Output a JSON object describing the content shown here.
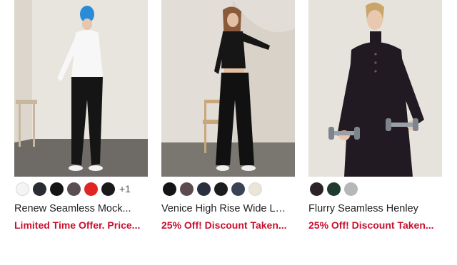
{
  "products": [
    {
      "name": "Renew Seamless Mock...",
      "promo": "Limited Time Offer. Price...",
      "swatches": [
        "#f4f4f4",
        "#2a2c33",
        "#141414",
        "#5a4e52",
        "#e02424",
        "#1a1a1a"
      ],
      "more": "+1"
    },
    {
      "name": "Venice High Rise Wide Leg",
      "promo": "25% Off! Discount Taken...",
      "swatches": [
        "#141414",
        "#5c4a4e",
        "#2a2f3f",
        "#1c1c1e",
        "#3a4356",
        "#ebe5d8"
      ]
    },
    {
      "name": "Flurry Seamless Henley",
      "promo": "25% Off! Discount Taken...",
      "swatches": [
        "#2a2226",
        "#1f3a2e",
        "#b7b7b7"
      ]
    }
  ]
}
